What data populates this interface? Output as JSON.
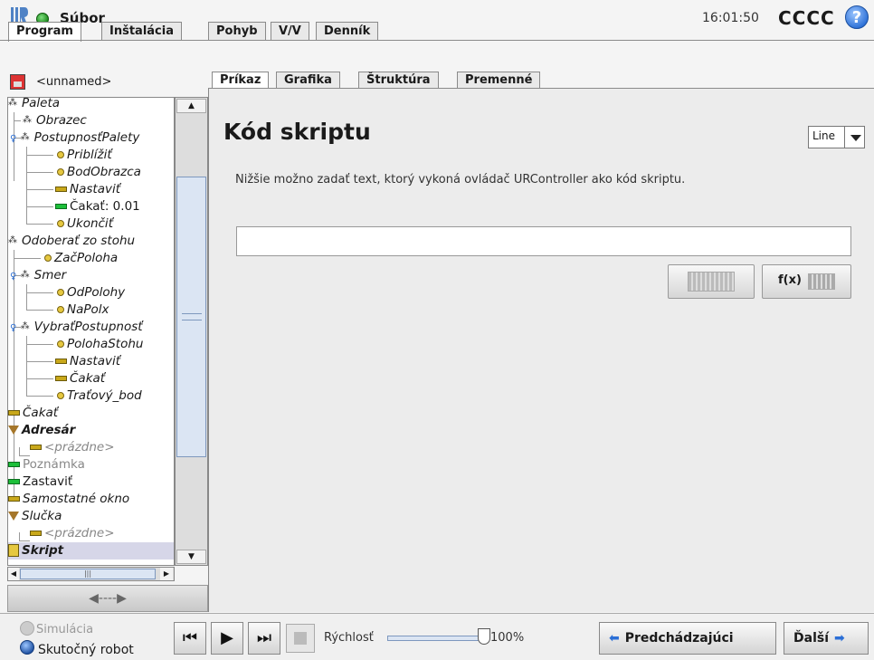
{
  "app": {
    "title": "Súbor",
    "clock": "16:01:50",
    "robot_name": "CCCC",
    "help_label": "?"
  },
  "main_tabs": [
    "Program",
    "Inštalácia",
    "Pohyb",
    "V/V",
    "Denník"
  ],
  "program_name": "<unnamed>",
  "sub_tabs": [
    "Príkaz",
    "Grafika",
    "Štruktúra",
    "Premenné"
  ],
  "tree": [
    "Paleta",
    "Obrazec",
    "PostupnosťPalety",
    "Priblížiť",
    "BodObrazca",
    "Nastaviť",
    "Čakať: 0.01",
    "Ukončiť",
    "Odoberať zo stohu",
    "ZačPoloha",
    "Smer",
    "OdPolohy",
    "NaPolx",
    "VybraťPostupnosť",
    "PolohaStohu",
    "Nastaviť",
    "Čakať",
    "Traťový_bod",
    "Čakať",
    "Adresár",
    "<prázdne>",
    "Poznámka",
    "Zastaviť",
    "Samostatné okno",
    "Slučka",
    "<prázdne>",
    "Skript"
  ],
  "content": {
    "heading": "Kód skriptu",
    "mode": "Line",
    "description": "Nižšie možno zadať text, ktorý vykoná ovládač URController ako kód skriptu.",
    "script_value": "",
    "fx_label": "f(x)"
  },
  "bottom": {
    "simulation": "Simulácia",
    "real_robot": "Skutočný robot",
    "speed_label": "Rýchlosť",
    "speed_value": "100%",
    "prev": "Predchádzajúci",
    "next": "Ďalší"
  },
  "colors": {
    "accent": "#2b6fd6",
    "wait_icon": "#c9a81a",
    "set_icon": "#1dbf3a"
  }
}
